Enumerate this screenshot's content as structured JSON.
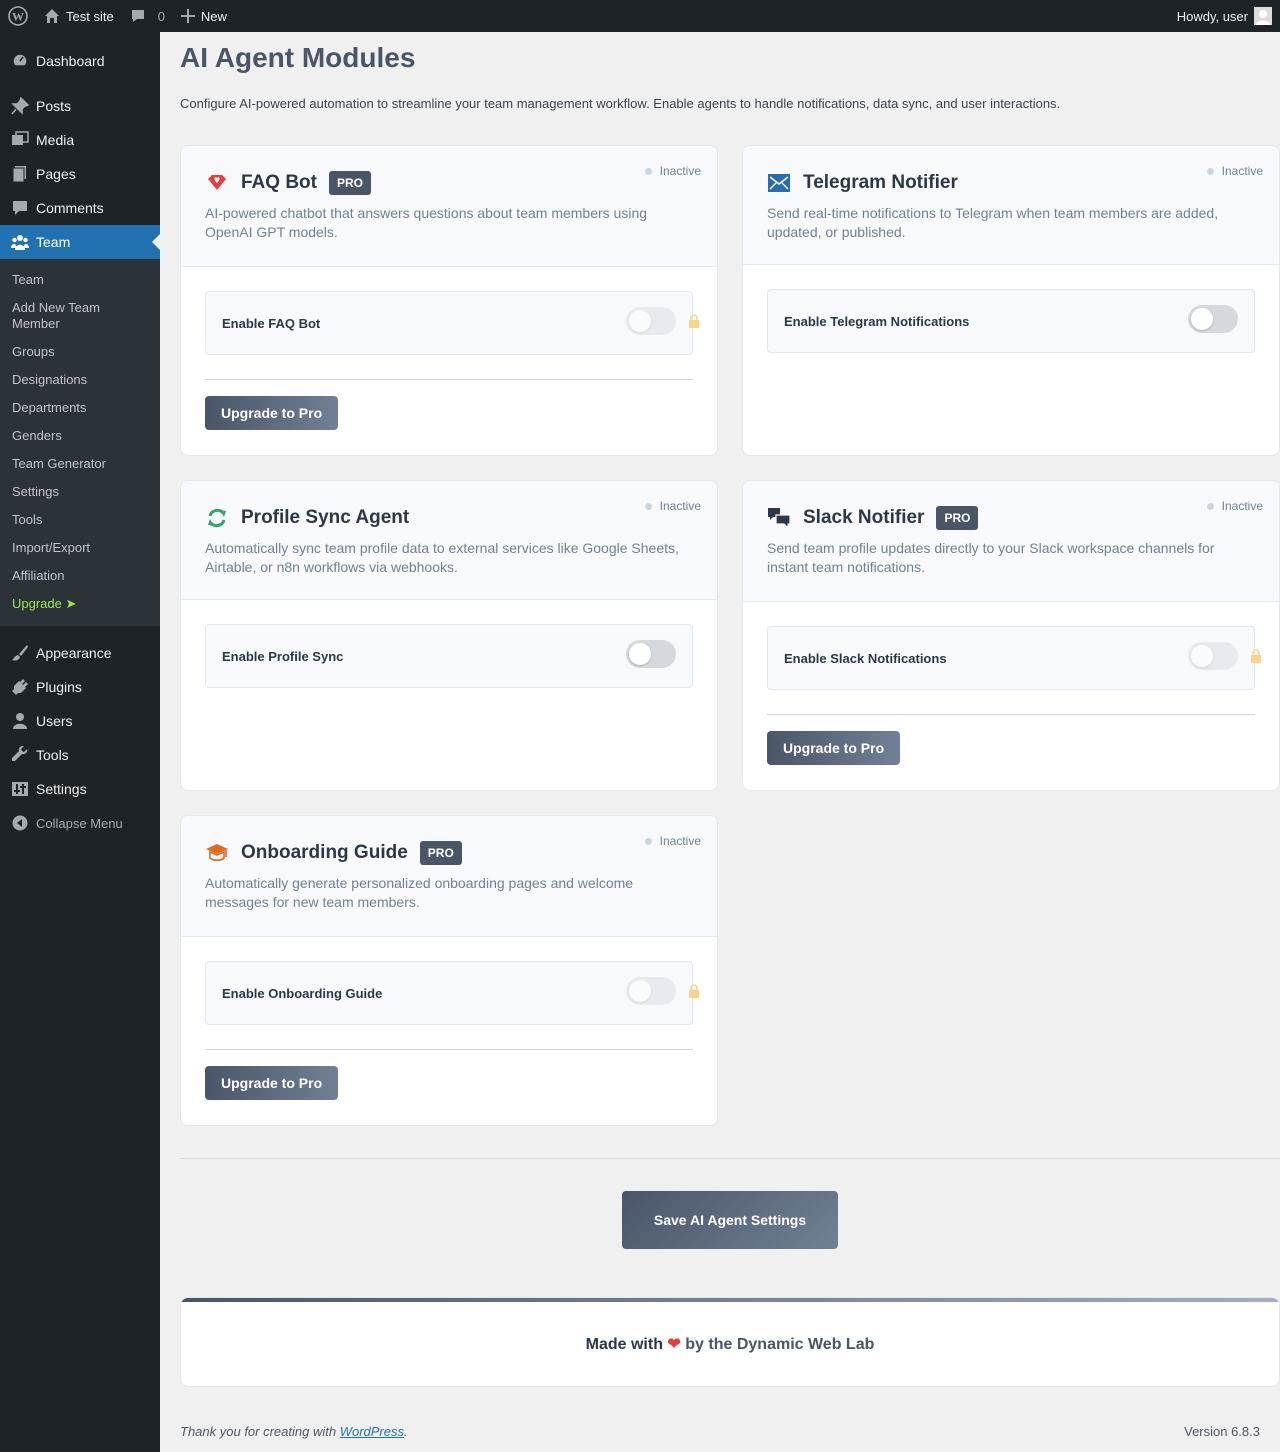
{
  "admin_bar": {
    "site_name": "Test site",
    "comments_count": "0",
    "new_label": "New",
    "howdy": "Howdy, user"
  },
  "sidebar": {
    "top_items": [
      {
        "label": "Dashboard",
        "icon": "dashboard-icon"
      },
      {
        "label": "Posts",
        "icon": "pin-icon"
      },
      {
        "label": "Media",
        "icon": "media-icon"
      },
      {
        "label": "Pages",
        "icon": "pages-icon"
      },
      {
        "label": "Comments",
        "icon": "comment-icon"
      },
      {
        "label": "Team",
        "icon": "team-icon"
      }
    ],
    "submenu": [
      "Team",
      "Add New Team Member",
      "Groups",
      "Designations",
      "Departments",
      "Genders",
      "Team Generator",
      "Settings",
      "Tools",
      "Import/Export",
      "Affiliation",
      "Upgrade ➤"
    ],
    "bottom_items": [
      {
        "label": "Appearance",
        "icon": "brush-icon"
      },
      {
        "label": "Plugins",
        "icon": "plug-icon"
      },
      {
        "label": "Users",
        "icon": "user-icon"
      },
      {
        "label": "Tools",
        "icon": "wrench-icon"
      },
      {
        "label": "Settings",
        "icon": "sliders-icon"
      }
    ],
    "collapse": "Collapse Menu"
  },
  "page": {
    "title": "AI Agent Modules",
    "description": "Configure AI-powered automation to streamline your team management workflow. Enable agents to handle notifications, data sync, and user interactions."
  },
  "modules": {
    "faq": {
      "title": "FAQ Bot",
      "badge": "PRO",
      "status": "Inactive",
      "description": "AI-powered chatbot that answers questions about team members using OpenAI GPT models.",
      "setting": "Enable FAQ Bot",
      "upgrade": "Upgrade to Pro",
      "icon": "heart-gem-icon",
      "icon_color": "#e53e3e"
    },
    "telegram": {
      "title": "Telegram Notifier",
      "status": "Inactive",
      "description": "Send real-time notifications to Telegram when team members are added, updated, or published.",
      "setting": "Enable Telegram Notifications",
      "icon": "envelope-icon",
      "icon_color": "#2b6cb0"
    },
    "profile_sync": {
      "title": "Profile Sync Agent",
      "status": "Inactive",
      "description": "Automatically sync team profile data to external services like Google Sheets, Airtable, or n8n workflows via webhooks.",
      "setting": "Enable Profile Sync",
      "icon": "sync-icon",
      "icon_color": "#38a169"
    },
    "slack": {
      "title": "Slack Notifier",
      "badge": "PRO",
      "status": "Inactive",
      "description": "Send team profile updates directly to your Slack workspace channels for instant team notifications.",
      "setting": "Enable Slack Notifications",
      "upgrade": "Upgrade to Pro",
      "icon": "chat-bubbles-icon",
      "icon_color": "#2d3748"
    },
    "onboarding": {
      "title": "Onboarding Guide",
      "badge": "PRO",
      "status": "Inactive",
      "description": "Automatically generate personalized onboarding pages and welcome messages for new team members.",
      "setting": "Enable Onboarding Guide",
      "upgrade": "Upgrade to Pro",
      "icon": "graduation-cap-icon",
      "icon_color": "#dd6b20"
    }
  },
  "save_button": "Save AI Agent Settings",
  "credit": {
    "made_with": "Made with",
    "heart": "❤",
    "by": "by the Dynamic Web Lab"
  },
  "footer": {
    "thanks": "Thank you for creating with ",
    "link": "WordPress",
    "period": ".",
    "version": "Version 6.8.3"
  }
}
